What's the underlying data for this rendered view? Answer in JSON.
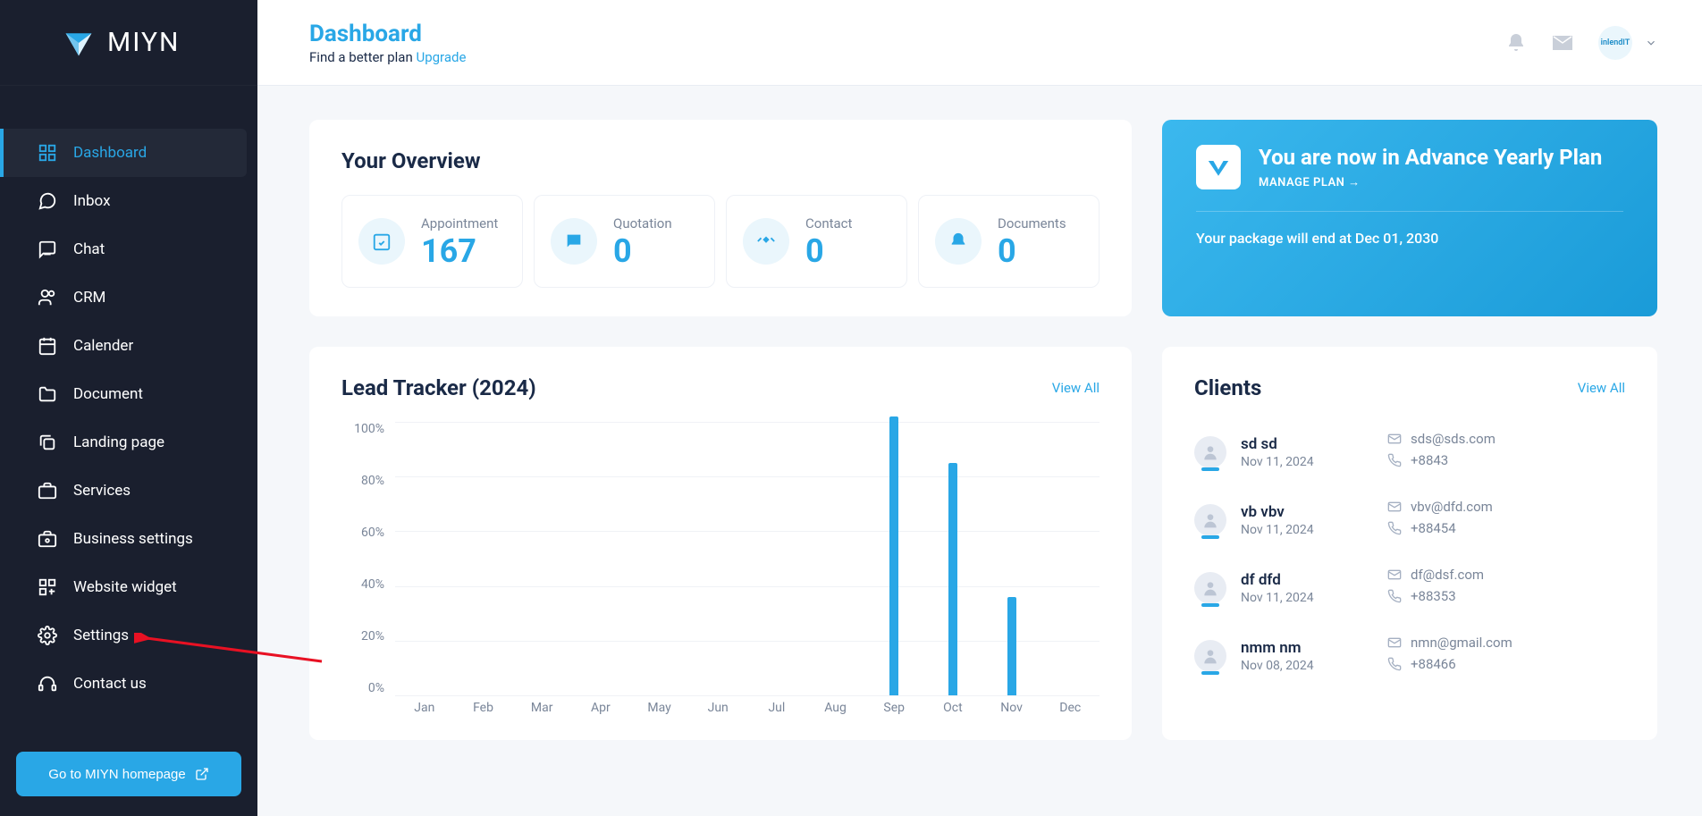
{
  "brand": {
    "name": "MIYN"
  },
  "nav": {
    "items": [
      {
        "label": "Dashboard",
        "icon": "grid",
        "active": true
      },
      {
        "label": "Inbox",
        "icon": "message"
      },
      {
        "label": "Chat",
        "icon": "chat"
      },
      {
        "label": "CRM",
        "icon": "users"
      },
      {
        "label": "Calender",
        "icon": "calendar"
      },
      {
        "label": "Document",
        "icon": "folder"
      },
      {
        "label": "Landing page",
        "icon": "copy"
      },
      {
        "label": "Services",
        "icon": "briefcase"
      },
      {
        "label": "Business settings",
        "icon": "briefcase-gear"
      },
      {
        "label": "Website widget",
        "icon": "widget"
      },
      {
        "label": "Settings",
        "icon": "gear"
      },
      {
        "label": "Contact us",
        "icon": "headset"
      }
    ],
    "homepage_btn": "Go to MIYN homepage"
  },
  "header": {
    "title": "Dashboard",
    "subtitle_text": "Find a better plan ",
    "upgrade_link": "Upgrade",
    "avatar_text": "inlendIT"
  },
  "overview": {
    "title": "Your Overview",
    "stats": [
      {
        "label": "Appointment",
        "value": "167",
        "icon": "calendar-check"
      },
      {
        "label": "Quotation",
        "value": "0",
        "icon": "quote"
      },
      {
        "label": "Contact",
        "value": "0",
        "icon": "handshake"
      },
      {
        "label": "Documents",
        "value": "0",
        "icon": "bell"
      }
    ]
  },
  "plan": {
    "title": "You are now in Advance Yearly Plan",
    "manage": "MANAGE PLAN →",
    "expiry": "Your package will end at Dec 01, 2030"
  },
  "lead": {
    "title": "Lead Tracker (2024)",
    "viewall": "View All"
  },
  "clients": {
    "title": "Clients",
    "viewall": "View All",
    "list": [
      {
        "name": "sd sd",
        "date": "Nov 11, 2024",
        "email": "sds@sds.com",
        "phone": "+8843"
      },
      {
        "name": "vb vbv",
        "date": "Nov 11, 2024",
        "email": "vbv@dfd.com",
        "phone": "+88454"
      },
      {
        "name": "df dfd",
        "date": "Nov 11, 2024",
        "email": "df@dsf.com",
        "phone": "+88353"
      },
      {
        "name": "nmm nm",
        "date": "Nov 08, 2024",
        "email": "nmn@gmail.com",
        "phone": "+88466"
      }
    ]
  },
  "chart_data": {
    "type": "bar",
    "categories": [
      "Jan",
      "Feb",
      "Mar",
      "Apr",
      "May",
      "Jun",
      "Jul",
      "Aug",
      "Sep",
      "Oct",
      "Nov",
      "Dec"
    ],
    "values": [
      0,
      0,
      0,
      0,
      0,
      0,
      0,
      0,
      102,
      85,
      36,
      0
    ],
    "title": "Lead Tracker (2024)",
    "xlabel": "",
    "ylabel": "",
    "ylim": [
      0,
      100
    ],
    "yticks": [
      "100%",
      "80%",
      "60%",
      "40%",
      "20%",
      "0%"
    ]
  },
  "annotation": {
    "target": "sidebar-item-settings"
  }
}
